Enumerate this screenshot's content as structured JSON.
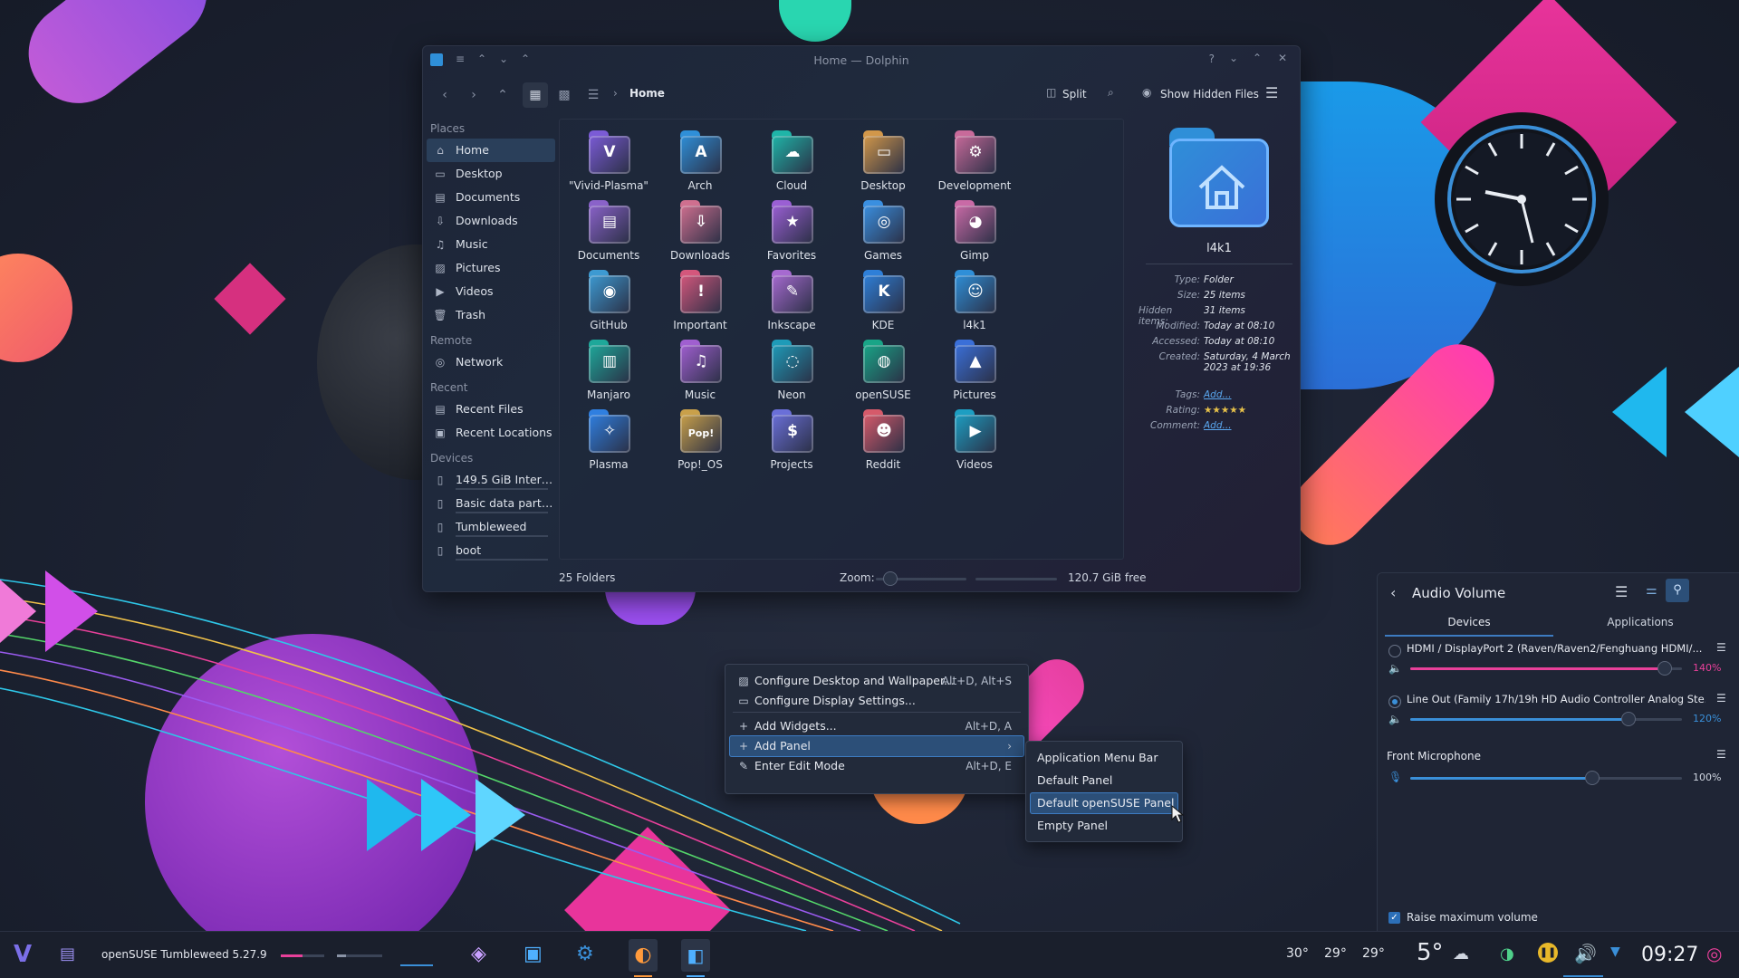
{
  "window": {
    "title": "Home — Dolphin",
    "breadcrumb": "Home",
    "split_label": "Split",
    "hidden_files_label": "Show Hidden Files"
  },
  "sidebar": {
    "places_heading": "Places",
    "places": [
      {
        "label": "Home",
        "icon": "home-icon"
      },
      {
        "label": "Desktop",
        "icon": "desktop-icon"
      },
      {
        "label": "Documents",
        "icon": "document-icon"
      },
      {
        "label": "Downloads",
        "icon": "download-icon"
      },
      {
        "label": "Music",
        "icon": "music-icon"
      },
      {
        "label": "Pictures",
        "icon": "picture-icon"
      },
      {
        "label": "Videos",
        "icon": "video-icon"
      },
      {
        "label": "Trash",
        "icon": "trash-icon"
      }
    ],
    "remote_heading": "Remote",
    "remote": [
      {
        "label": "Network",
        "icon": "network-icon"
      }
    ],
    "recent_heading": "Recent",
    "recent": [
      {
        "label": "Recent Files",
        "icon": "recent-files-icon"
      },
      {
        "label": "Recent Locations",
        "icon": "recent-locations-icon"
      }
    ],
    "devices_heading": "Devices",
    "devices": [
      {
        "label": "149.5 GiB Internal ...",
        "icon": "drive-icon"
      },
      {
        "label": "Basic data partiti...",
        "icon": "drive-icon"
      },
      {
        "label": "Tumbleweed",
        "icon": "drive-icon"
      },
      {
        "label": "boot",
        "icon": "drive-icon"
      }
    ]
  },
  "folders": [
    {
      "label": "\"Vivid-Plasma\"",
      "glyph": "V",
      "color": "#7b5bd6"
    },
    {
      "label": "Arch",
      "glyph": "A",
      "color": "#2f8fd8"
    },
    {
      "label": "Cloud",
      "glyph": "☁",
      "color": "#1fb5a8"
    },
    {
      "label": "Desktop",
      "glyph": "▭",
      "color": "#d1974a"
    },
    {
      "label": "Development",
      "glyph": "⚙",
      "color": "#c86a9a"
    },
    {
      "label": "Documents",
      "glyph": "▤",
      "color": "#8a62c9"
    },
    {
      "label": "Downloads",
      "glyph": "⇩",
      "color": "#cf6f8f"
    },
    {
      "label": "Favorites",
      "glyph": "★",
      "color": "#9a5fd4"
    },
    {
      "label": "Games",
      "glyph": "◎",
      "color": "#3a8fe0"
    },
    {
      "label": "Gimp",
      "glyph": "◕",
      "color": "#c96aa6"
    },
    {
      "label": "GitHub",
      "glyph": "◉",
      "color": "#3d9ad2"
    },
    {
      "label": "Important",
      "glyph": "!",
      "color": "#d4577c"
    },
    {
      "label": "Inkscape",
      "glyph": "✎",
      "color": "#a66ad0"
    },
    {
      "label": "KDE",
      "glyph": "K",
      "color": "#2e7fd8"
    },
    {
      "label": "l4k1",
      "glyph": "☺",
      "color": "#2f8fd8"
    },
    {
      "label": "Manjaro",
      "glyph": "▥",
      "color": "#1ea89a"
    },
    {
      "label": "Music",
      "glyph": "♫",
      "color": "#a05fd0"
    },
    {
      "label": "Neon",
      "glyph": "◌",
      "color": "#1e9bb8"
    },
    {
      "label": "openSUSE",
      "glyph": "◍",
      "color": "#19a587"
    },
    {
      "label": "Pictures",
      "glyph": "▲",
      "color": "#3a6fd8"
    },
    {
      "label": "Plasma",
      "glyph": "✧",
      "color": "#2f7fe0"
    },
    {
      "label": "Pop!_OS",
      "glyph": "Pop!",
      "color": "#c9a04a"
    },
    {
      "label": "Projects",
      "glyph": "$",
      "color": "#6a6fd8"
    },
    {
      "label": "Reddit",
      "glyph": "☻",
      "color": "#d65a6a"
    },
    {
      "label": "Videos",
      "glyph": "▶",
      "color": "#1d9ec2"
    }
  ],
  "info_panel": {
    "name": "l4k1",
    "rows": [
      {
        "key": "Type:",
        "value": "Folder"
      },
      {
        "key": "Size:",
        "value": "25 items"
      },
      {
        "key": "Hidden items:",
        "value": "31 items"
      },
      {
        "key": "Modified:",
        "value": "Today at 08:10"
      },
      {
        "key": "Accessed:",
        "value": "Today at 08:10"
      },
      {
        "key": "Created:",
        "value": "Saturday, 4 March 2023 at 19:36"
      },
      {
        "key": "Tags:",
        "value": "Add..."
      },
      {
        "key": "Rating:",
        "value": "★★★★★"
      },
      {
        "key": "Comment:",
        "value": "Add..."
      }
    ]
  },
  "statusbar": {
    "folders": "25 Folders",
    "zoom_label": "Zoom:",
    "free": "120.7 GiB free",
    "zoom_level": 0.15,
    "space_used": 0.0
  },
  "context_menu": {
    "items": [
      {
        "label": "Configure Desktop and Wallpaper...",
        "shortcut": "Alt+D, Alt+S",
        "icon": "wallpaper-icon"
      },
      {
        "label": "Configure Display Settings...",
        "shortcut": "",
        "icon": "display-icon"
      },
      {
        "label": "Add Widgets...",
        "shortcut": "Alt+D, A",
        "icon": "plus-icon"
      },
      {
        "label": "Add Panel",
        "shortcut": "",
        "icon": "plus-icon"
      },
      {
        "label": "Enter Edit Mode",
        "shortcut": "Alt+D, E",
        "icon": "pencil-icon"
      }
    ],
    "submenu": [
      "Application Menu Bar",
      "Default Panel",
      "Default openSUSE Panel",
      "Empty Panel"
    ]
  },
  "audio": {
    "title": "Audio Volume",
    "tab_devices": "Devices",
    "tab_applications": "Applications",
    "devices": [
      {
        "name": "HDMI / DisplayPort 2 (Raven/Raven2/Fenghuang HDMI/...",
        "percent": "140%",
        "level": 140,
        "color": "#e8409a",
        "selected": false
      },
      {
        "name": "Line Out (Family 17h/19h HD Audio Controller Analog Ste...",
        "percent": "120%",
        "level": 120,
        "color": "#3a8fd8",
        "selected": true
      }
    ],
    "microphone": {
      "name": "Front Microphone",
      "percent": "100%",
      "level": 100
    },
    "raise_label": "Raise maximum volume"
  },
  "taskbar": {
    "os_label": "openSUSE Tumbleweed 5.27.9",
    "temps": [
      "30°",
      "29°",
      "29°"
    ],
    "weather_temp": "5°",
    "clock": "09:27"
  }
}
